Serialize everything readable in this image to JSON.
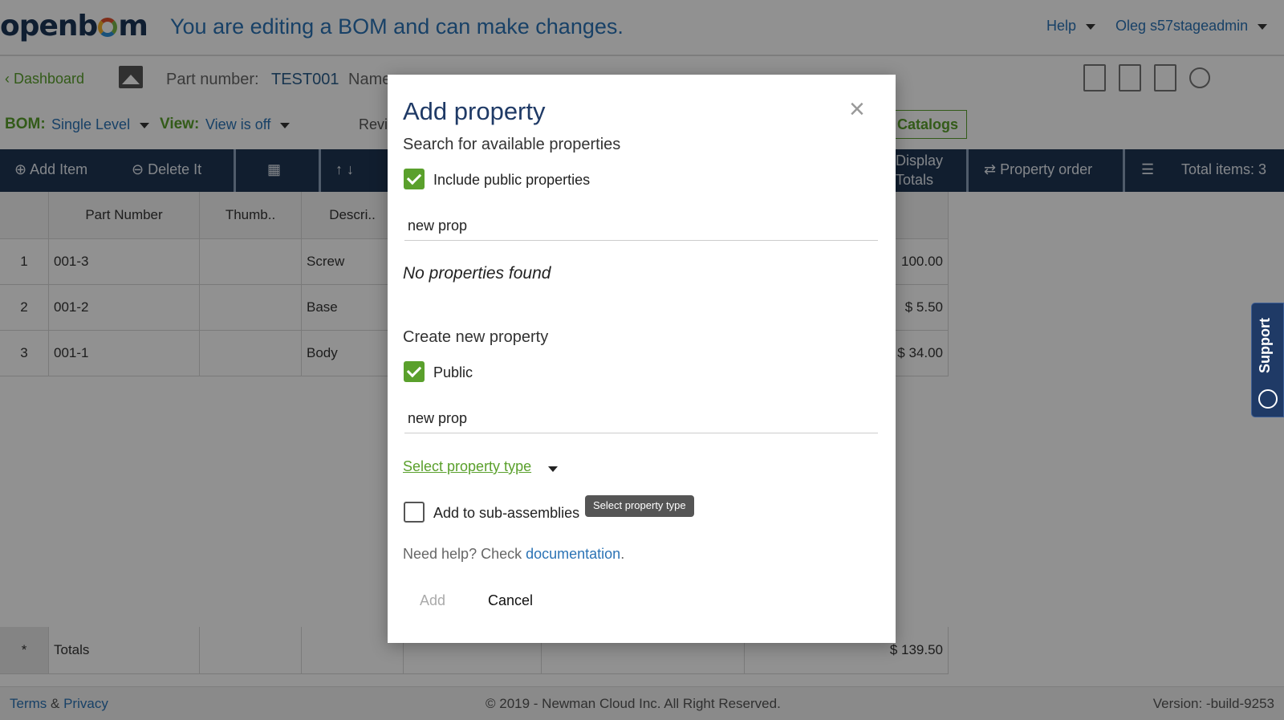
{
  "header": {
    "logo": "openbom",
    "edit_message": "You are editing a BOM and can make changes.",
    "help_label": "Help",
    "user_label": "Oleg s57stageadmin"
  },
  "subheader": {
    "dashboard_label": "Dashboard",
    "part_number_label": "Part number:",
    "part_number_value": "TEST001",
    "name_label": "Name"
  },
  "bom_bar": {
    "bom_label": "BOM:",
    "bom_value": "Single Level",
    "view_label": "View:",
    "view_value": "View is off",
    "revisions_label": "Revi",
    "catalogs_label": "nd Catalogs"
  },
  "toolbar": {
    "add_item": "Add Item",
    "delete_item": "Delete It",
    "display_totals_1": "Display",
    "display_totals_2": "Totals",
    "property_order": "Property order",
    "total_items": "Total items: 3"
  },
  "grid": {
    "headers": [
      "Part Number",
      "Thumb..",
      "Descri.."
    ],
    "rows": [
      {
        "index": "1",
        "part": "001-3",
        "desc": "Screw",
        "cost": "100.00"
      },
      {
        "index": "2",
        "part": "001-2",
        "desc": "Base",
        "cost": "$ 5.50"
      },
      {
        "index": "3",
        "part": "001-1",
        "desc": "Body",
        "cost": "$ 34.00"
      }
    ],
    "totals_marker": "*",
    "totals_label": "Totals",
    "totals_value": "$ 139.50"
  },
  "modal": {
    "title": "Add property",
    "search_heading": "Search for available properties",
    "include_public_label": "Include public properties",
    "search_value": "new prop",
    "no_results": "No properties found",
    "create_heading": "Create new property",
    "public_label": "Public",
    "new_name_value": "new prop",
    "select_type_label": "Select property type",
    "tooltip": "Select property type",
    "sub_assemblies_label": "Add to sub-assemblies",
    "help_prefix": "Need help? Check ",
    "help_link": "documentation",
    "help_suffix": ".",
    "add_button": "Add",
    "cancel_button": "Cancel",
    "close_glyph": "×"
  },
  "support": {
    "label": "Support"
  },
  "footer": {
    "terms": "Terms",
    "amp": "&",
    "privacy": "Privacy",
    "copyright": "© 2019 - Newman Cloud Inc. All Right Reserved.",
    "version": "Version: -build-9253"
  },
  "colors": {
    "brand_navy": "#1f3554",
    "accent_green": "#5aa02c",
    "link_blue": "#2b73b5"
  }
}
